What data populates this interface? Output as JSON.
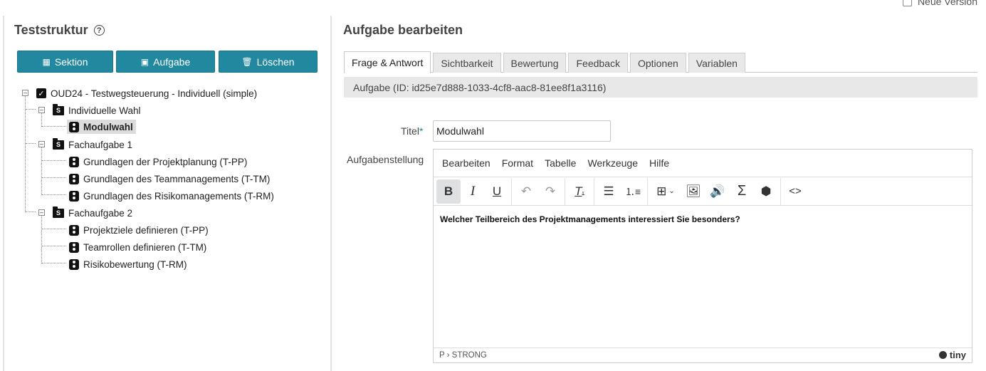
{
  "top": {
    "new_version_label": "Neue Version"
  },
  "left": {
    "title": "Teststruktur",
    "buttons": {
      "section": "Sektion",
      "task": "Aufgabe",
      "delete": "Löschen"
    },
    "tree": {
      "root": "OUD24 - Testwegsteuerung - Individuell (simple)",
      "section1": "Individuelle Wahl",
      "section1_items": [
        "Modulwahl"
      ],
      "section2": "Fachaufgabe 1",
      "section2_items": [
        "Grundlagen der Projektplanung (T-PP)",
        "Grundlagen des Teammanagements (T-TM)",
        "Grundlagen des Risikomanagements (T-RM)"
      ],
      "section3": "Fachaufgabe 2",
      "section3_items": [
        "Projektziele definieren (T-PP)",
        "Teamrollen definieren (T-TM)",
        "Risikobewertung (T-RM)"
      ]
    }
  },
  "right": {
    "title": "Aufgabe bearbeiten",
    "tabs": [
      "Frage & Antwort",
      "Sichtbarkeit",
      "Bewertung",
      "Feedback",
      "Optionen",
      "Variablen"
    ],
    "info": "Aufgabe (ID: id25e7d888-1033-4cf8-aac8-81ee8f1a3116)",
    "title_label": "Titel",
    "required_mark": "*",
    "title_value": "Modulwahl",
    "task_label": "Aufgabenstellung",
    "editor": {
      "menu": [
        "Bearbeiten",
        "Format",
        "Tabelle",
        "Werkzeuge",
        "Hilfe"
      ],
      "content": "Welcher Teilbereich des Projektmanagements interessiert Sie besonders?",
      "path": "P › STRONG",
      "brand": "tiny"
    }
  },
  "colors": {
    "button": "#2188a0",
    "tab_bg": "#e9e9e9",
    "info_bg": "#e8e8e8",
    "required": "#2188a0"
  }
}
